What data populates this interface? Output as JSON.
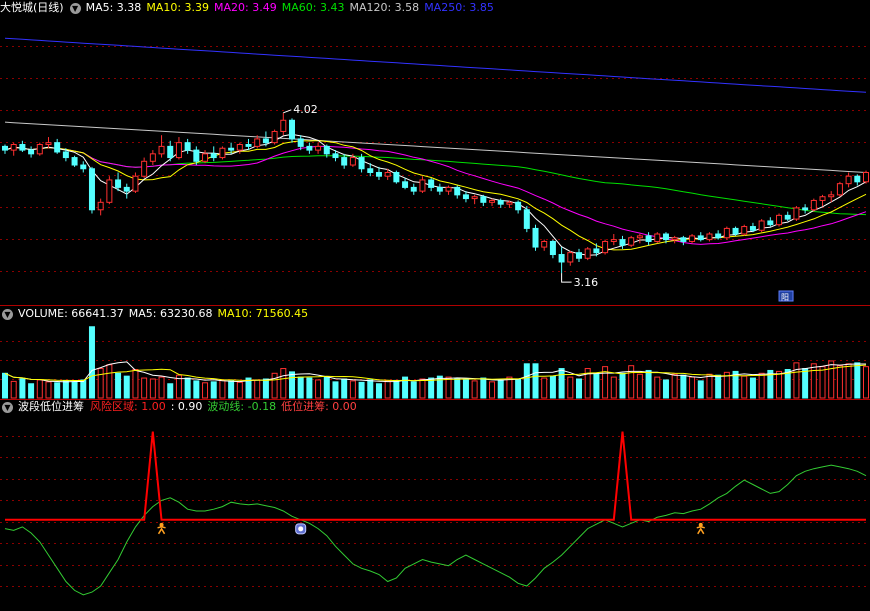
{
  "colors": {
    "up": "#ff3030",
    "down": "#54ffff",
    "ma5": "#ffffff",
    "ma10": "#ffff00",
    "ma20": "#ff00ff",
    "ma60": "#00e000",
    "ma120": "#c8c8c8",
    "ma250": "#3232ff",
    "grid": "#8b0000",
    "risk": "#ff0000",
    "wave": "#33cc33",
    "lowentry": "#ff4040",
    "separator": "#b00000",
    "text": "#ffffff"
  },
  "icons": [
    "chevron-down-icon",
    "info-icon",
    "buy-person-icon",
    "cup-icon"
  ],
  "price_panel": {
    "stock": "大悦城(日线)",
    "legend": [
      {
        "label": "MA5: 3.38",
        "color": "#ffffff"
      },
      {
        "label": "MA10: 3.39",
        "color": "#ffff00"
      },
      {
        "label": "MA20: 3.49",
        "color": "#ff00ff"
      },
      {
        "label": "MA60: 3.43",
        "color": "#00e000"
      },
      {
        "label": "MA120: 3.58",
        "color": "#c8c8c8"
      },
      {
        "label": "MA250: 3.85",
        "color": "#3232ff"
      }
    ],
    "high_label": "4.02",
    "low_label": "3.16",
    "info_label": "阳"
  },
  "volume_panel": {
    "legend": [
      {
        "label": "VOLUME: 66641.37",
        "color": "#ffffff"
      },
      {
        "label": "MA5: 63230.68",
        "color": "#ffffff"
      },
      {
        "label": "MA10: 71560.45",
        "color": "#ffff00"
      }
    ]
  },
  "indicator_panel": {
    "title": "波段低位进筹",
    "legend": [
      {
        "label": "风险区域: 1.00",
        "color": "#ff2020"
      },
      {
        "label": ": 0.90",
        "color": "#ffffff"
      },
      {
        "label": "波动线: -0.18",
        "color": "#33cc33"
      },
      {
        "label": "低位进筹: 0.00",
        "color": "#ff4040"
      }
    ]
  },
  "chart_data": {
    "type": "candlestick",
    "count": 100,
    "price_range": [
      3.0,
      4.55
    ],
    "ohlc": [
      [
        3.84,
        3.85,
        3.8,
        3.82
      ],
      [
        3.82,
        3.86,
        3.79,
        3.85
      ],
      [
        3.85,
        3.87,
        3.81,
        3.82
      ],
      [
        3.82,
        3.84,
        3.78,
        3.8
      ],
      [
        3.8,
        3.86,
        3.79,
        3.85
      ],
      [
        3.85,
        3.89,
        3.83,
        3.86
      ],
      [
        3.86,
        3.88,
        3.8,
        3.81
      ],
      [
        3.81,
        3.83,
        3.76,
        3.78
      ],
      [
        3.78,
        3.79,
        3.73,
        3.74
      ],
      [
        3.74,
        3.76,
        3.7,
        3.72
      ],
      [
        3.72,
        3.73,
        3.48,
        3.5
      ],
      [
        3.5,
        3.56,
        3.47,
        3.54
      ],
      [
        3.54,
        3.68,
        3.53,
        3.66
      ],
      [
        3.66,
        3.7,
        3.6,
        3.62
      ],
      [
        3.62,
        3.64,
        3.56,
        3.6
      ],
      [
        3.6,
        3.7,
        3.59,
        3.68
      ],
      [
        3.68,
        3.78,
        3.67,
        3.76
      ],
      [
        3.76,
        3.82,
        3.74,
        3.8
      ],
      [
        3.8,
        3.9,
        3.78,
        3.84
      ],
      [
        3.84,
        3.87,
        3.76,
        3.78
      ],
      [
        3.78,
        3.89,
        3.77,
        3.86
      ],
      [
        3.86,
        3.88,
        3.8,
        3.82
      ],
      [
        3.82,
        3.84,
        3.74,
        3.76
      ],
      [
        3.76,
        3.82,
        3.75,
        3.8
      ],
      [
        3.8,
        3.84,
        3.76,
        3.78
      ],
      [
        3.78,
        3.84,
        3.77,
        3.83
      ],
      [
        3.83,
        3.86,
        3.8,
        3.82
      ],
      [
        3.82,
        3.86,
        3.8,
        3.85
      ],
      [
        3.85,
        3.88,
        3.82,
        3.84
      ],
      [
        3.84,
        3.9,
        3.83,
        3.88
      ],
      [
        3.88,
        3.92,
        3.84,
        3.86
      ],
      [
        3.86,
        3.93,
        3.85,
        3.92
      ],
      [
        3.92,
        4.02,
        3.9,
        3.98
      ],
      [
        3.98,
        3.99,
        3.86,
        3.88
      ],
      [
        3.88,
        3.9,
        3.82,
        3.84
      ],
      [
        3.84,
        3.86,
        3.8,
        3.82
      ],
      [
        3.82,
        3.86,
        3.8,
        3.84
      ],
      [
        3.84,
        3.85,
        3.78,
        3.8
      ],
      [
        3.8,
        3.82,
        3.76,
        3.78
      ],
      [
        3.78,
        3.8,
        3.72,
        3.74
      ],
      [
        3.74,
        3.8,
        3.73,
        3.78
      ],
      [
        3.78,
        3.8,
        3.7,
        3.72
      ],
      [
        3.72,
        3.75,
        3.68,
        3.7
      ],
      [
        3.7,
        3.73,
        3.66,
        3.68
      ],
      [
        3.68,
        3.72,
        3.66,
        3.7
      ],
      [
        3.7,
        3.71,
        3.64,
        3.65
      ],
      [
        3.65,
        3.67,
        3.61,
        3.62
      ],
      [
        3.62,
        3.64,
        3.58,
        3.6
      ],
      [
        3.6,
        3.68,
        3.59,
        3.66
      ],
      [
        3.66,
        3.67,
        3.6,
        3.62
      ],
      [
        3.62,
        3.64,
        3.58,
        3.6
      ],
      [
        3.6,
        3.63,
        3.58,
        3.62
      ],
      [
        3.62,
        3.63,
        3.56,
        3.58
      ],
      [
        3.58,
        3.6,
        3.54,
        3.56
      ],
      [
        3.56,
        3.58,
        3.53,
        3.57
      ],
      [
        3.57,
        3.58,
        3.52,
        3.54
      ],
      [
        3.54,
        3.56,
        3.52,
        3.55
      ],
      [
        3.55,
        3.56,
        3.51,
        3.53
      ],
      [
        3.53,
        3.55,
        3.51,
        3.54
      ],
      [
        3.54,
        3.55,
        3.48,
        3.5
      ],
      [
        3.5,
        3.52,
        3.38,
        3.4
      ],
      [
        3.4,
        3.42,
        3.28,
        3.3
      ],
      [
        3.3,
        3.34,
        3.28,
        3.33
      ],
      [
        3.33,
        3.34,
        3.24,
        3.26
      ],
      [
        3.26,
        3.3,
        3.16,
        3.22
      ],
      [
        3.22,
        3.28,
        3.2,
        3.27
      ],
      [
        3.27,
        3.29,
        3.22,
        3.24
      ],
      [
        3.24,
        3.3,
        3.23,
        3.29
      ],
      [
        3.29,
        3.32,
        3.25,
        3.27
      ],
      [
        3.27,
        3.34,
        3.26,
        3.33
      ],
      [
        3.33,
        3.37,
        3.31,
        3.34
      ],
      [
        3.34,
        3.36,
        3.29,
        3.31
      ],
      [
        3.31,
        3.36,
        3.3,
        3.35
      ],
      [
        3.35,
        3.37,
        3.32,
        3.36
      ],
      [
        3.36,
        3.38,
        3.31,
        3.33
      ],
      [
        3.33,
        3.38,
        3.32,
        3.37
      ],
      [
        3.37,
        3.38,
        3.32,
        3.34
      ],
      [
        3.34,
        3.36,
        3.32,
        3.35
      ],
      [
        3.35,
        3.36,
        3.31,
        3.33
      ],
      [
        3.33,
        3.37,
        3.32,
        3.36
      ],
      [
        3.36,
        3.38,
        3.33,
        3.34
      ],
      [
        3.34,
        3.38,
        3.33,
        3.37
      ],
      [
        3.37,
        3.39,
        3.34,
        3.35
      ],
      [
        3.35,
        3.41,
        3.34,
        3.4
      ],
      [
        3.4,
        3.41,
        3.36,
        3.37
      ],
      [
        3.37,
        3.42,
        3.36,
        3.41
      ],
      [
        3.41,
        3.43,
        3.38,
        3.39
      ],
      [
        3.39,
        3.45,
        3.38,
        3.44
      ],
      [
        3.44,
        3.46,
        3.41,
        3.42
      ],
      [
        3.42,
        3.48,
        3.41,
        3.47
      ],
      [
        3.47,
        3.49,
        3.44,
        3.45
      ],
      [
        3.45,
        3.52,
        3.44,
        3.51
      ],
      [
        3.51,
        3.53,
        3.48,
        3.5
      ],
      [
        3.5,
        3.56,
        3.49,
        3.55
      ],
      [
        3.55,
        3.58,
        3.52,
        3.57
      ],
      [
        3.57,
        3.6,
        3.54,
        3.58
      ],
      [
        3.58,
        3.65,
        3.57,
        3.64
      ],
      [
        3.64,
        3.7,
        3.62,
        3.68
      ],
      [
        3.68,
        3.69,
        3.63,
        3.65
      ],
      [
        3.65,
        3.71,
        3.64,
        3.7
      ]
    ],
    "ma250": [
      4.42,
      4.13
    ],
    "ma120": [
      3.97,
      3.7
    ],
    "volume_range": [
      0,
      160000
    ],
    "volume": [
      52000,
      35000,
      40000,
      30000,
      38000,
      34000,
      32000,
      36000,
      34000,
      38000,
      150000,
      62000,
      70000,
      52000,
      46000,
      60000,
      42000,
      40000,
      44000,
      30000,
      48000,
      42000,
      36000,
      32000,
      34000,
      38000,
      36000,
      33000,
      42000,
      38000,
      40000,
      52000,
      62000,
      55000,
      44000,
      42000,
      38000,
      45000,
      34000,
      40000,
      36000,
      33000,
      38000,
      30000,
      36000,
      37000,
      44000,
      34000,
      40000,
      42000,
      46000,
      44000,
      40000,
      38000,
      36000,
      42000,
      34000,
      38000,
      44000,
      40000,
      72000,
      72000,
      42000,
      46000,
      62000,
      44000,
      40000,
      62000,
      50000,
      66000,
      44000,
      52000,
      68000,
      50000,
      58000,
      44000,
      38000,
      50000,
      48000,
      44000,
      36000,
      50000,
      48000,
      54000,
      56000,
      46000,
      42000,
      52000,
      58000,
      56000,
      60000,
      74000,
      62000,
      72000,
      66000,
      78000,
      68000,
      72000,
      74000,
      66000
    ],
    "risk_baseline": 0.0,
    "risk_spikes": [
      {
        "index": 17,
        "value": 1.0
      },
      {
        "index": 71,
        "value": 1.0
      }
    ],
    "wave_range": [
      -1.0,
      1.2
    ],
    "wave": [
      -0.1,
      -0.12,
      -0.08,
      -0.15,
      -0.25,
      -0.4,
      -0.55,
      -0.7,
      -0.8,
      -0.85,
      -0.82,
      -0.75,
      -0.6,
      -0.45,
      -0.25,
      -0.08,
      0.05,
      0.15,
      0.22,
      0.25,
      0.2,
      0.12,
      0.1,
      0.1,
      0.12,
      0.15,
      0.2,
      0.18,
      0.17,
      0.18,
      0.16,
      0.14,
      0.1,
      0.04,
      0,
      -0.04,
      -0.1,
      -0.18,
      -0.3,
      -0.4,
      -0.5,
      -0.55,
      -0.58,
      -0.62,
      -0.7,
      -0.66,
      -0.55,
      -0.5,
      -0.45,
      -0.48,
      -0.5,
      -0.52,
      -0.45,
      -0.4,
      -0.45,
      -0.5,
      -0.55,
      -0.6,
      -0.65,
      -0.72,
      -0.75,
      -0.66,
      -0.55,
      -0.48,
      -0.4,
      -0.3,
      -0.2,
      -0.1,
      -0.05,
      0,
      -0.04,
      -0.08,
      -0.04,
      0,
      -0.02,
      0.03,
      0.05,
      0.08,
      0.07,
      0.1,
      0.12,
      0.18,
      0.25,
      0.3,
      0.38,
      0.45,
      0.4,
      0.35,
      0.3,
      0.32,
      0.4,
      0.5,
      0.55,
      0.58,
      0.6,
      0.62,
      0.6,
      0.58,
      0.55,
      0.5
    ],
    "signals": [
      {
        "index": 18,
        "kind": "buy"
      },
      {
        "index": 34,
        "kind": "cup"
      },
      {
        "index": 80,
        "kind": "buy"
      }
    ]
  }
}
